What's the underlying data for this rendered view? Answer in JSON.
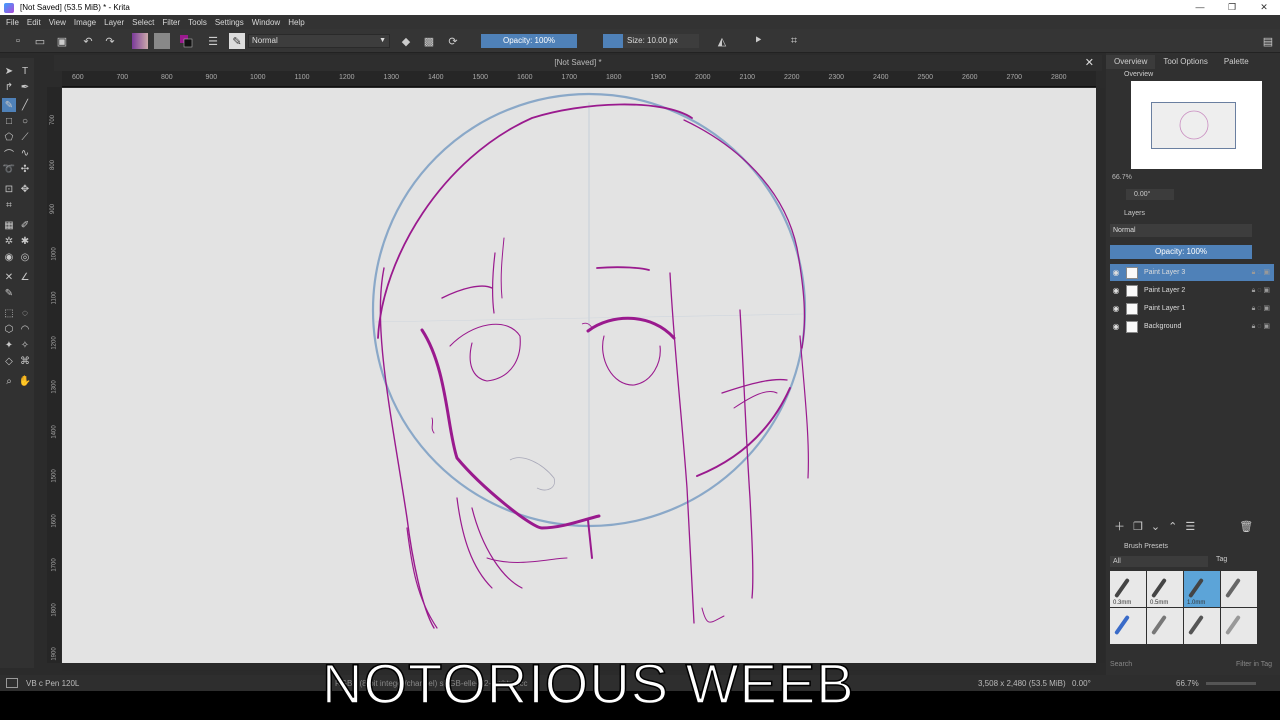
{
  "window": {
    "title": "[Not Saved] (53.5 MiB) * - Krita",
    "controls": [
      "—",
      "❐",
      "✕"
    ]
  },
  "menu": [
    "File",
    "Edit",
    "View",
    "Image",
    "Layer",
    "Select",
    "Filter",
    "Tools",
    "Settings",
    "Window",
    "Help"
  ],
  "toolbar": {
    "blend_mode": "Normal",
    "opacity": "Opacity: 100%",
    "size": "Size: 10.00 px"
  },
  "document": {
    "tab_title": "[Not Saved] *",
    "ruler_labels": [
      "600",
      "700",
      "800",
      "900",
      "1000",
      "1100",
      "1200",
      "1300",
      "1400",
      "1500",
      "1600",
      "1700",
      "1800",
      "1900",
      "2000",
      "2100",
      "2200",
      "2300",
      "2400",
      "2500",
      "2600",
      "2700",
      "2800"
    ],
    "vruler_labels": [
      "700",
      "800",
      "900",
      "1000",
      "1100",
      "1200",
      "1300",
      "1400",
      "1500",
      "1600",
      "1700",
      "1800",
      "1900"
    ]
  },
  "dock": {
    "tabs": [
      "Overview",
      "Tool Options",
      "Palette"
    ],
    "overview_title": "Overview",
    "zoom": "66.7%",
    "rotation": "0.00°",
    "layers_title": "Layers",
    "layer_blend": "Normal",
    "layer_opacity": "Opacity: 100%",
    "layers": [
      {
        "name": "Paint Layer 3",
        "active": true
      },
      {
        "name": "Paint Layer 2",
        "active": false
      },
      {
        "name": "Paint Layer 1",
        "active": false
      },
      {
        "name": "Background",
        "active": false
      }
    ],
    "presets_title": "Brush Presets",
    "preset_filter": "All",
    "tag_label": "Tag",
    "presets": [
      "0.3mm",
      "0.5mm",
      "1.0mm",
      "",
      "",
      "",
      "",
      ""
    ],
    "search_placeholder": "Search",
    "filter_tag": "Filter in Tag"
  },
  "status": {
    "brush": "VB c Pen 120L",
    "image_info": "RGBA (8-bit integer/channel) sRGB-elle-V2-srgbtrc.icc",
    "dimensions": "3,508 x 2,480 (53.5 MiB)",
    "rotation": "0.00°",
    "zoom": "66.7%"
  },
  "overlay_text": "NOTORIOUS WEEB",
  "colors": {
    "accent": "#4f81b8",
    "sketch_stroke": "#9a1a8e",
    "guide_circle": "#8aa8c8",
    "canvas": "#e3e3e3"
  }
}
